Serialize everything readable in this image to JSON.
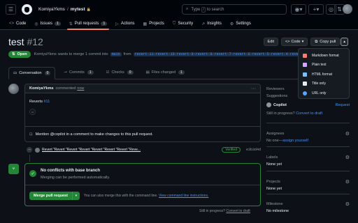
{
  "header": {
    "owner": "KomiyaYkms",
    "separator": "/",
    "repo": "mytest",
    "search_text": "Type",
    "search_kbd": "/",
    "search_suffix": "to search"
  },
  "repo_tabs": [
    {
      "label": "Code",
      "icon": "<>"
    },
    {
      "label": "Issues",
      "icon": "◎",
      "count": "1"
    },
    {
      "label": "Pull requests",
      "icon": "⇅",
      "count": "1"
    },
    {
      "label": "Actions",
      "icon": "▷"
    },
    {
      "label": "Projects",
      "icon": "▦"
    },
    {
      "label": "Security",
      "icon": "⛉"
    },
    {
      "label": "Insights",
      "icon": "↗"
    },
    {
      "label": "Settings",
      "icon": "⚙"
    }
  ],
  "pr": {
    "title": "test",
    "number": "#12",
    "state": "Open",
    "status_user": "KomiyaYkms",
    "status_text": "wants to merge 1 commit into",
    "base_branch": "main",
    "from_text": "from",
    "head_branch": "revert-11-revert-10-revert-9-revert-8-revert-7-revert-6-revert-5-revert-4-revert-3-revert-1-..."
  },
  "actions": {
    "edit": "Edit",
    "code": "Code",
    "copy": "Copy pull"
  },
  "copy_menu": [
    {
      "label": "Markdown format",
      "color": "#ff7b72"
    },
    {
      "label": "Plain text",
      "color": "#d2a8ff"
    },
    {
      "label": "HTML format",
      "color": "#79c0ff"
    },
    {
      "label": "Title only",
      "color": "#e6edf3"
    },
    {
      "label": "URL only",
      "color": "#58a6ff"
    }
  ],
  "pr_tabs": [
    {
      "label": "Conversation",
      "count": "0",
      "icon": "▭"
    },
    {
      "label": "Commits",
      "count": "1",
      "icon": "⊸"
    },
    {
      "label": "Checks",
      "count": "0",
      "icon": "☑"
    },
    {
      "label": "Files changed",
      "count": "1",
      "icon": "▤"
    }
  ],
  "comment": {
    "user": "KomiyaYkms",
    "meta": "commented",
    "time": "now",
    "body_prefix": "Reverts",
    "body_link": "#11",
    "copilot_text": "Mention @copilot in a comment to make changes to this pull request."
  },
  "commit": {
    "message": "Revert \"Revert \"Revert \"Revert \"Revert \"Revert \"Revert \"Reve...",
    "verified": "Verified",
    "sha": "e3b3d4d"
  },
  "merge": {
    "title": "No conflicts with base branch",
    "subtitle": "Merging can be performed automatically.",
    "button": "Merge pull request",
    "hint": "You can also merge this with the command line.",
    "hint_link": "View command line instructions."
  },
  "progress_note": {
    "text": "Still in progress?",
    "link": "Convert to draft"
  },
  "sidebar": {
    "reviewers": {
      "heading": "Reviewers",
      "suggestions": "Suggestions",
      "suggested": "Copilot",
      "request": "Request",
      "progress": "Still in progress?",
      "convert": "Convert to draft"
    },
    "assignees": {
      "heading": "Assignees",
      "value": "No one—",
      "link": "assign yourself"
    },
    "labels": {
      "heading": "Labels",
      "value": "None yet"
    },
    "projects": {
      "heading": "Projects",
      "value": "None yet"
    },
    "milestone": {
      "heading": "Milestone",
      "value": "No milestone"
    }
  }
}
